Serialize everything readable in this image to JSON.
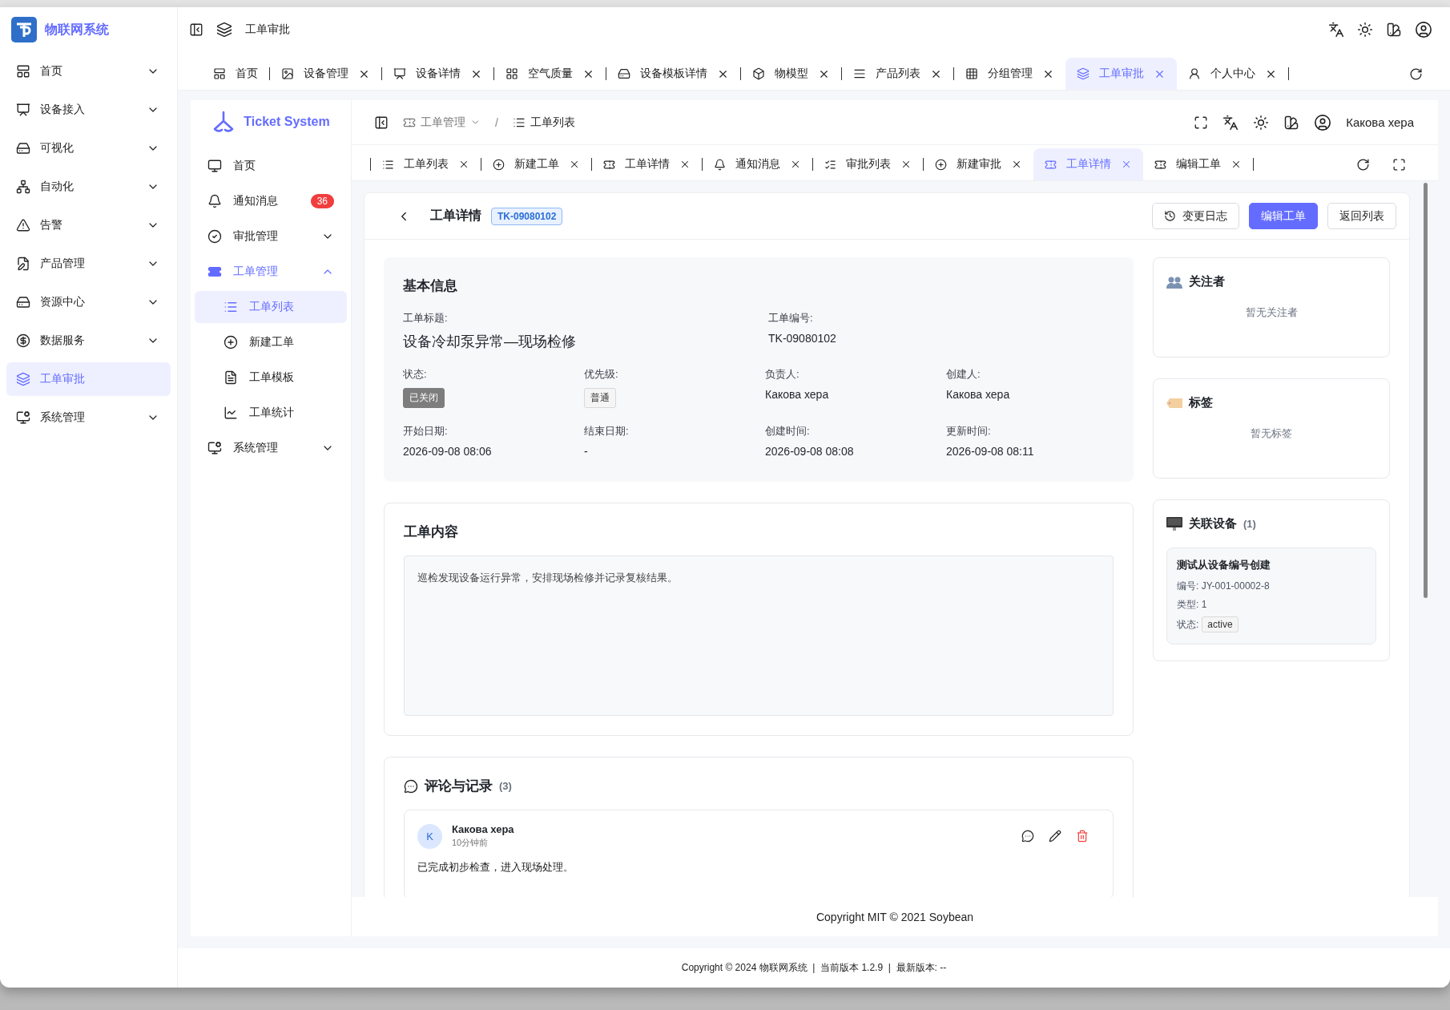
{
  "app": {
    "title": "物联网系统"
  },
  "sidebar": {
    "items": [
      {
        "label": "首页",
        "expandable": true,
        "selected": false
      },
      {
        "label": "设备接入",
        "expandable": true,
        "selected": false
      },
      {
        "label": "可视化",
        "expandable": true,
        "selected": false
      },
      {
        "label": "自动化",
        "expandable": true,
        "selected": false
      },
      {
        "label": "告警",
        "expandable": true,
        "selected": false
      },
      {
        "label": "产品管理",
        "expandable": true,
        "selected": false
      },
      {
        "label": "资源中心",
        "expandable": true,
        "selected": false
      },
      {
        "label": "数据服务",
        "expandable": true,
        "selected": false
      },
      {
        "label": "工单审批",
        "expandable": false,
        "selected": true
      },
      {
        "label": "系统管理",
        "expandable": true,
        "selected": false
      }
    ]
  },
  "header": {
    "breadcrumb": "工单审批"
  },
  "tabs": [
    {
      "label": "首页",
      "closable": false,
      "selected": false
    },
    {
      "label": "设备管理",
      "closable": true,
      "selected": false
    },
    {
      "label": "设备详情",
      "closable": true,
      "selected": false
    },
    {
      "label": "空气质量",
      "closable": true,
      "selected": false
    },
    {
      "label": "设备模板详情",
      "closable": true,
      "selected": false
    },
    {
      "label": "物模型",
      "closable": true,
      "selected": false
    },
    {
      "label": "产品列表",
      "closable": true,
      "selected": false
    },
    {
      "label": "分组管理",
      "closable": true,
      "selected": false
    },
    {
      "label": "工单审批",
      "closable": true,
      "selected": true
    },
    {
      "label": "个人中心",
      "closable": true,
      "selected": false
    }
  ],
  "inner_sidebar": {
    "brand": "Ticket System",
    "items": [
      {
        "label": "首页",
        "selected": false
      },
      {
        "label": "通知消息",
        "badge": "36",
        "selected": false
      },
      {
        "label": "审批管理",
        "expanded": false,
        "selected": false
      },
      {
        "label": "工单管理",
        "expanded": true,
        "selected": false,
        "children": [
          {
            "label": "工单列表",
            "selected": true
          },
          {
            "label": "新建工单",
            "selected": false
          },
          {
            "label": "工单模板",
            "selected": false
          },
          {
            "label": "工单统计",
            "selected": false
          }
        ]
      },
      {
        "label": "系统管理",
        "expanded": false,
        "selected": false
      }
    ]
  },
  "inner_header": {
    "separator": "/",
    "breadcrumb": [
      {
        "label": "工单管理",
        "dropdown": true
      },
      {
        "label": "工单列表",
        "dropdown": false
      }
    ],
    "user": "Какова хера"
  },
  "inner_tabs": [
    {
      "label": "工单列表",
      "selected": false
    },
    {
      "label": "新建工单",
      "selected": false
    },
    {
      "label": "工单详情",
      "selected": false
    },
    {
      "label": "通知消息",
      "selected": false
    },
    {
      "label": "审批列表",
      "selected": false
    },
    {
      "label": "新建审批",
      "selected": false
    },
    {
      "label": "工单详情",
      "selected": true
    },
    {
      "label": "编辑工单",
      "selected": false
    }
  ],
  "detail": {
    "title": "工单详情",
    "code": "TK-09080102",
    "buttons": [
      {
        "label": "变更日志",
        "kind": "history"
      },
      {
        "label": "编辑工单",
        "kind": "primary"
      },
      {
        "label": "返回列表",
        "kind": "default"
      }
    ],
    "basic_info": {
      "title": "基本信息",
      "rows": [
        [
          {
            "label": "工单标题:",
            "value": "设备冷却泵异常—现场检修",
            "kind": "headline"
          },
          "",
          {
            "label": "工单编号:",
            "value": "TK-09080102",
            "kind": "text"
          }
        ],
        [
          {
            "label": "状态:",
            "value": "已关闭",
            "kind": "solid"
          },
          {
            "label": "优先级:",
            "value": "普通",
            "kind": "outline"
          },
          {
            "label": "负责人:",
            "value": "Какова хера",
            "kind": "text"
          },
          {
            "label": "创建人:",
            "value": "Какова хера",
            "kind": "text"
          }
        ],
        [
          {
            "label": "开始日期:",
            "value": "2026-09-08 08:06",
            "kind": "text"
          },
          {
            "label": "结束日期:",
            "value": "-",
            "kind": "text"
          },
          {
            "label": "创建时间:",
            "value": "2026-09-08 08:08",
            "kind": "text"
          },
          {
            "label": "更新时间:",
            "value": "2026-09-08 08:11",
            "kind": "text"
          }
        ]
      ]
    },
    "content": {
      "title": "工单内容",
      "text": "巡检发现设备运行异常，安排现场检修并记录复核结果。"
    },
    "comments": {
      "title": "评论与记录",
      "count": "(3)",
      "items": [
        {
          "avatar": "K",
          "author": "Какова хера",
          "time": "10分钟前",
          "text": "已完成初步检查，进入现场处理。"
        }
      ]
    },
    "watchers": {
      "title": "关注者",
      "empty": "暂无关注者"
    },
    "tags": {
      "title": "标签",
      "empty": "暂无标签"
    },
    "devices": {
      "title": "关联设备",
      "count": "(1)",
      "items": [
        {
          "name": "测试从设备编号创建",
          "code": "编号: JY-001-00002-8",
          "type": "类型: 1",
          "status_label": "状态:",
          "status": "active"
        }
      ]
    }
  },
  "inner_footer": "Copyright MIT © 2021 Soybean",
  "footer": "Copyright © 2024 物联网系统  |  当前版本 1.2.9  |  最新版本: --"
}
